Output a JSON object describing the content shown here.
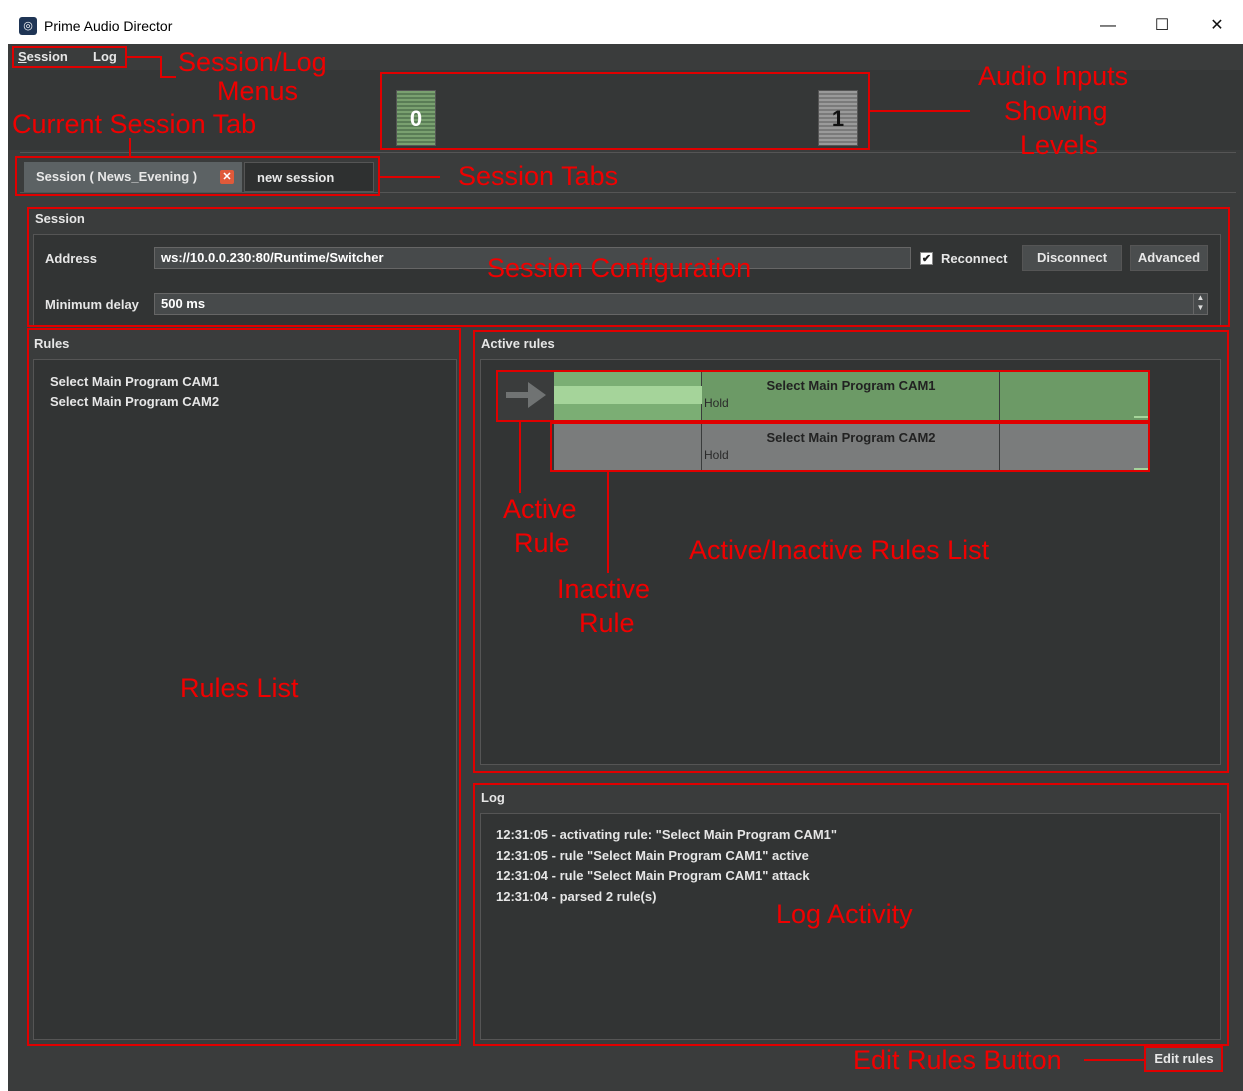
{
  "window": {
    "title": "Prime Audio Director",
    "controls": {
      "minimize": "—",
      "maximize": "☐",
      "close": "✕"
    }
  },
  "menu": {
    "session_mnemonic": "S",
    "session_rest": "ession",
    "log": "Log"
  },
  "audio_inputs": [
    {
      "label": "0",
      "state": "active"
    },
    {
      "label": "1",
      "state": "idle"
    }
  ],
  "tabs": {
    "current": "Session ( News_Evening )",
    "new": "new session",
    "close_glyph": "✕"
  },
  "session": {
    "panel_title": "Session",
    "address_label": "Address",
    "address_value": "ws://10.0.0.230:80/Runtime/Switcher",
    "reconnect_label": "Reconnect",
    "reconnect_checked": "✔",
    "disconnect_label": "Disconnect",
    "advanced_label": "Advanced",
    "min_delay_label": "Minimum delay",
    "min_delay_value": "500 ms"
  },
  "rules": {
    "panel_title": "Rules",
    "items": [
      "Select Main Program CAM1",
      "Select Main Program CAM2"
    ]
  },
  "active_rules": {
    "panel_title": "Active rules",
    "rows": [
      {
        "name": "Select Main Program CAM1",
        "mode": "Hold",
        "state": "active"
      },
      {
        "name": "Select Main Program CAM2",
        "mode": "Hold",
        "state": "inactive"
      }
    ]
  },
  "log": {
    "panel_title": "Log",
    "lines": [
      "12:31:05 - activating rule: \"Select Main Program CAM1\"",
      "12:31:05 - rule \"Select Main Program CAM1\" active",
      "12:31:04 - rule \"Select Main Program CAM1\" attack",
      "12:31:04 - parsed 2 rule(s)"
    ]
  },
  "edit_rules_label": "Edit rules",
  "annotations": {
    "menus_line1": "Session/Log",
    "menus_line2": "Menus",
    "audio_line1": "Audio Inputs",
    "audio_line2": "Showing",
    "audio_line3": "Levels",
    "current_tab": "Current Session Tab",
    "session_tabs": "Session Tabs",
    "session_config": "Session Configuration",
    "active_rule_line1": "Active",
    "active_rule_line2": "Rule",
    "inactive_rule_line1": "Inactive",
    "inactive_rule_line2": "Rule",
    "rules_list_list": "Active/Inactive Rules List",
    "rules_list": "Rules List",
    "log_activity": "Log Activity",
    "edit_rules_button": "Edit Rules Button"
  },
  "colors": {
    "annotation": "#e00000",
    "active_rule": "#6c9a66",
    "inactive_rule": "#7a7c7c",
    "background": "#3a3c3c"
  }
}
